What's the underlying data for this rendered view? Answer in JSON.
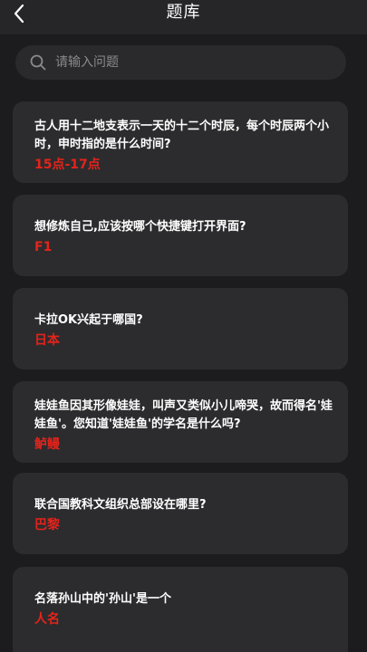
{
  "header": {
    "title": "题库",
    "back_icon": "chevron-left-icon"
  },
  "search": {
    "placeholder": "请输入问题",
    "value": "",
    "icon": "search-icon"
  },
  "colors": {
    "background": "#1c1c1e",
    "card": "#2c2c2e",
    "answer": "#e5231b",
    "question": "#ffffff"
  },
  "questions": [
    {
      "question": "古人用十二地支表示一天的十二个时辰，每个时辰两个小时，申时指的是什么时间?",
      "answer": "15点-17点"
    },
    {
      "question": "想修炼自己,应该按哪个快捷键打开界面?",
      "answer": "F1"
    },
    {
      "question": "卡拉OK兴起于哪国?",
      "answer": "日本"
    },
    {
      "question": "娃娃鱼因其形像娃娃，叫声又类似小儿啼哭，故而得名'娃娃鱼'。您知道'娃娃鱼'的学名是什么吗?",
      "answer": "鲈鳗"
    },
    {
      "question": "联合国教科文组织总部设在哪里?",
      "answer": "巴黎"
    },
    {
      "question": "名落孙山中的'孙山'是一个",
      "answer": "人名"
    }
  ]
}
